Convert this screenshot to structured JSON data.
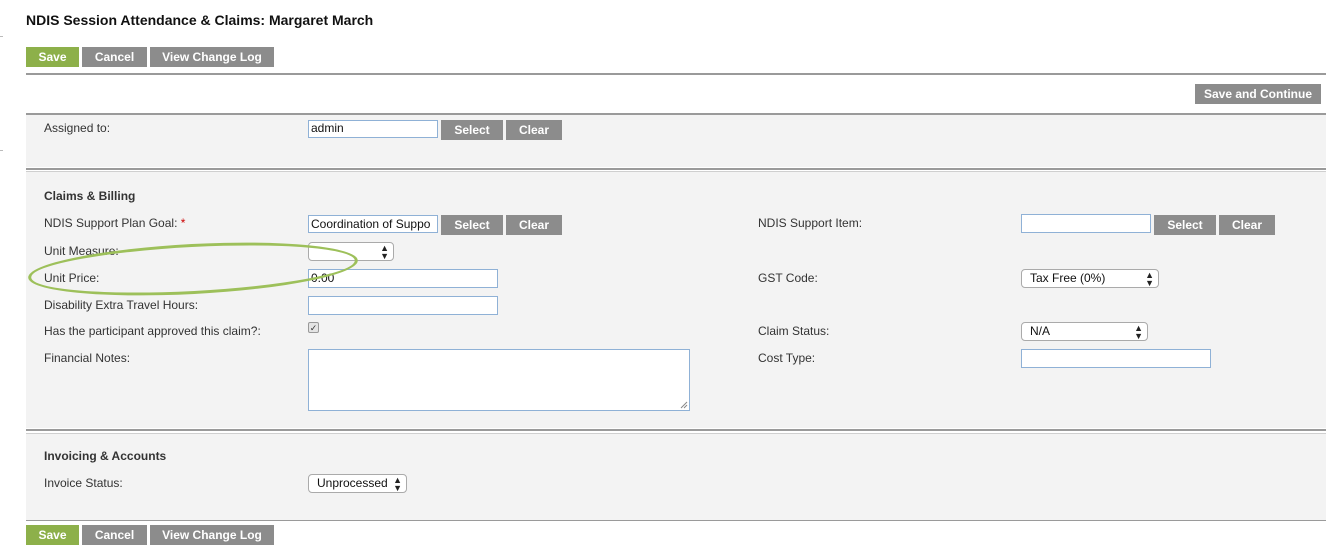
{
  "page": {
    "title": "NDIS Session Attendance & Claims: Margaret March"
  },
  "toolbar": {
    "save": "Save",
    "cancel": "Cancel",
    "view_change_log": "View Change Log",
    "save_continue": "Save and Continue"
  },
  "assigned": {
    "label": "Assigned to:",
    "value": "admin",
    "select": "Select",
    "clear": "Clear"
  },
  "claims": {
    "title": "Claims & Billing",
    "goal_label": "NDIS Support Plan Goal:",
    "goal_required": "*",
    "goal_value": "Coordination of Suppo",
    "select": "Select",
    "clear": "Clear",
    "unit_measure_label": "Unit Measure:",
    "unit_measure_value": "",
    "unit_price_label": "Unit Price:",
    "unit_price_value": "0.00",
    "travel_label": "Disability Extra Travel Hours:",
    "travel_value": "",
    "approved_label": "Has the participant approved this claim?:",
    "approved_checked": true,
    "financial_notes_label": "Financial Notes:",
    "financial_notes_value": "",
    "support_item_label": "NDIS Support Item:",
    "support_item_value": "",
    "gst_label": "GST Code:",
    "gst_value": "Tax Free (0%)",
    "claim_status_label": "Claim Status:",
    "claim_status_value": "N/A",
    "cost_type_label": "Cost Type:",
    "cost_type_value": ""
  },
  "invoicing": {
    "title": "Invoicing & Accounts",
    "status_label": "Invoice Status:",
    "status_value": "Unprocessed"
  },
  "colors": {
    "primary_button": "#8db04a",
    "secondary_button": "#8c8c8c",
    "highlight_circle": "#9dc05a"
  },
  "icons": {
    "select_arrow": "up-down-arrows-icon",
    "checkbox": "checkmark-icon",
    "resize": "resize-grip-icon"
  }
}
